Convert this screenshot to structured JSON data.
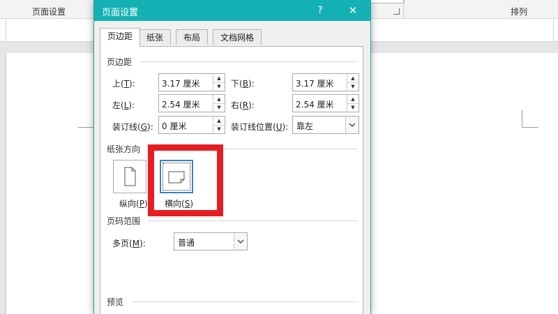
{
  "ribbon": {
    "page_setup_group": "页面设置",
    "arrange_group": "排列"
  },
  "dialog": {
    "title": "页面设置",
    "help": "?",
    "close": "✕",
    "tabs": [
      {
        "label": "页边距",
        "active": true
      },
      {
        "label": "纸张",
        "active": false
      },
      {
        "label": "布局",
        "active": false
      },
      {
        "label": "文档网格",
        "active": false
      }
    ],
    "margins": {
      "section": "页边距",
      "top": {
        "label": "上",
        "key": "T",
        "value": "3.17 厘米"
      },
      "bottom": {
        "label": "下",
        "key": "B",
        "value": "3.17 厘米"
      },
      "left": {
        "label": "左",
        "key": "L",
        "value": "2.54 厘米"
      },
      "right": {
        "label": "右",
        "key": "R",
        "value": "2.54 厘米"
      },
      "gutter": {
        "label": "装订线",
        "key": "G",
        "value": "0 厘米"
      },
      "gutter_pos": {
        "label": "装订线位置",
        "key": "U",
        "value": "靠左"
      }
    },
    "orientation": {
      "section": "纸张方向",
      "portrait": {
        "label": "纵向",
        "key": "P"
      },
      "landscape": {
        "label": "横向",
        "key": "S",
        "selected": true
      }
    },
    "pages": {
      "section": "页码范围",
      "multiple": {
        "label": "多页",
        "key": "M",
        "value": "普通"
      }
    },
    "preview": {
      "section": "预览"
    }
  },
  "colors": {
    "titlebar": "#14b1b4",
    "highlight": "#e61e24",
    "selected_border": "#3c7fc4"
  }
}
